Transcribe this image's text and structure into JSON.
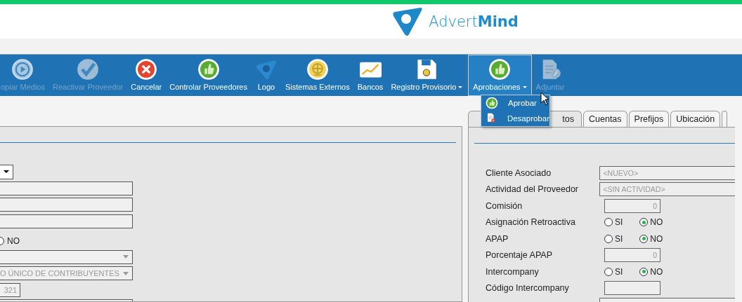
{
  "header": {
    "logo_text": "Advert**Mind**"
  },
  "toolbar": [
    {
      "label": "opiar Medios",
      "kind": "play",
      "disabled": true,
      "dropdown": false,
      "selected": false
    },
    {
      "label": "Reactivar Proveedor",
      "kind": "check",
      "disabled": true,
      "dropdown": false,
      "selected": false
    },
    {
      "label": "Cancelar",
      "kind": "cancel",
      "disabled": false,
      "dropdown": false,
      "selected": false
    },
    {
      "label": "Controlar Proveedores",
      "kind": "thumb",
      "disabled": false,
      "dropdown": false,
      "selected": false
    },
    {
      "label": "Logo",
      "kind": "drop",
      "disabled": false,
      "dropdown": false,
      "selected": false
    },
    {
      "label": "Sistemas Externos",
      "kind": "globe",
      "disabled": false,
      "dropdown": false,
      "selected": false
    },
    {
      "label": "Bancos",
      "kind": "chart",
      "disabled": false,
      "dropdown": false,
      "selected": false
    },
    {
      "label": "Registro Provisorio",
      "kind": "disk",
      "disabled": false,
      "dropdown": true,
      "selected": false
    },
    {
      "label": "Aprobaciones",
      "kind": "thumb",
      "disabled": false,
      "dropdown": true,
      "selected": true
    },
    {
      "label": "Adjuntar",
      "kind": "doc",
      "disabled": true,
      "dropdown": false,
      "selected": false
    }
  ],
  "menu": [
    {
      "label": "Aprobar",
      "kind": "thumb"
    },
    {
      "label": "Desaprobar",
      "kind": "docx"
    }
  ],
  "left_panel": {
    "rows": [
      {
        "kind": "combo"
      },
      {
        "kind": "text"
      },
      {
        "kind": "text"
      },
      {
        "kind": "text"
      },
      {
        "kind": "radio",
        "option": "NO",
        "selected": false
      },
      {
        "kind": "select"
      },
      {
        "kind": "select",
        "value": "O ÚNICO DE CONTRIBUYENTES"
      },
      {
        "kind": "small",
        "value": "321"
      },
      {
        "kind": "text"
      }
    ]
  },
  "tabs": [
    {
      "label": "tos",
      "selected": true
    },
    {
      "label": "Cuentas",
      "selected": false
    },
    {
      "label": "Prefijos",
      "selected": false
    },
    {
      "label": "Ubicación",
      "selected": false
    },
    {
      "selected": false
    }
  ],
  "form": [
    {
      "label": "Cliente Asociado",
      "kind": "wide",
      "value": "<NUEVO>"
    },
    {
      "label": "Actividad del Proveedor",
      "kind": "wide",
      "value": "<SIN ACTIVIDAD>"
    },
    {
      "label": "Comisión",
      "kind": "number",
      "value": "0"
    },
    {
      "label": "Asignación Retroactiva",
      "kind": "radio",
      "options": [
        {
          "label": "SI",
          "selected": false
        },
        {
          "label": "NO",
          "selected": true
        }
      ]
    },
    {
      "label": "APAP",
      "kind": "radio",
      "options": [
        {
          "label": "SI",
          "selected": false
        },
        {
          "label": "NO",
          "selected": true
        }
      ]
    },
    {
      "label": "Porcentaje APAP",
      "kind": "number",
      "value": "0"
    },
    {
      "label": "Intercompany",
      "kind": "radio",
      "options": [
        {
          "label": "SI",
          "selected": false
        },
        {
          "label": "NO",
          "selected": true
        }
      ]
    },
    {
      "label": "Código Intercompany",
      "kind": "number"
    },
    {
      "kind": "wide"
    }
  ]
}
